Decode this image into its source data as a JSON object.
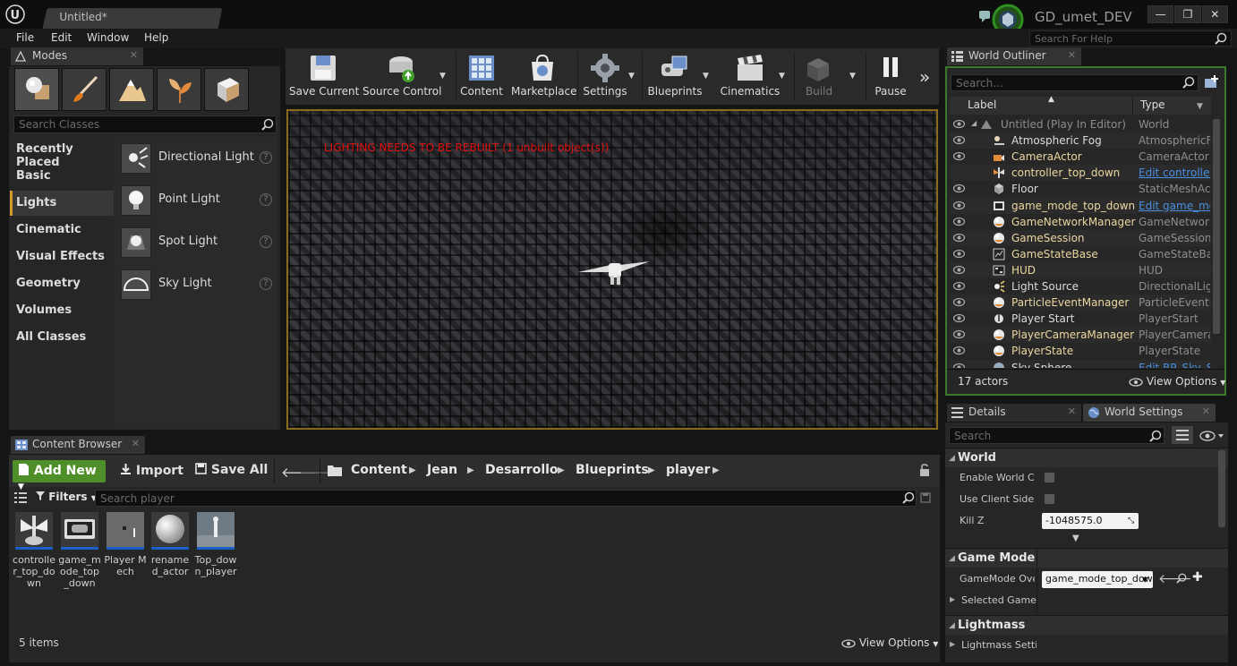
{
  "app": {
    "doc_tab": "Untitled*",
    "project_name": "GD_umet_DEV",
    "window_buttons": [
      "—",
      "❐",
      "✕"
    ]
  },
  "menu": {
    "items": [
      "File",
      "Edit",
      "Window",
      "Help"
    ],
    "search_placeholder": "Search For Help"
  },
  "modes": {
    "tab_label": "Modes",
    "search_placeholder": "Search Classes",
    "categories": [
      "Recently Placed",
      "Basic",
      "Lights",
      "Cinematic",
      "Visual Effects",
      "Geometry",
      "Volumes",
      "All Classes"
    ],
    "active_category": "Lights",
    "lights": [
      "Directional Light",
      "Point Light",
      "Spot Light",
      "Sky Light"
    ],
    "help_glyph": "?"
  },
  "toolbar": {
    "buttons": [
      "Save Current",
      "Source Control",
      "Content",
      "Marketplace",
      "Settings",
      "Blueprints",
      "Cinematics",
      "Build",
      "Pause"
    ],
    "more_glyph": "»"
  },
  "viewport": {
    "warning": "LIGHTING NEEDS TO BE REBUILT (1 unbuilt object(s))",
    "warning_color": "#e01010",
    "border_color": "#8a6b1c"
  },
  "outliner": {
    "tab_label": "World Outliner",
    "search_placeholder": "Search...",
    "col_label": "Label",
    "col_type": "Type",
    "rows": [
      {
        "label": "Untitled (Play In Editor)",
        "type": "World",
        "style": "dim",
        "type_style": "",
        "icon": "world-icon"
      },
      {
        "label": "Atmospheric Fog",
        "type": "AtmosphericFog",
        "style": "",
        "type_style": "",
        "icon": "fog-icon"
      },
      {
        "label": "CameraActor",
        "type": "CameraActor",
        "style": "bp",
        "type_style": "",
        "icon": "camera-icon"
      },
      {
        "label": "controller_top_down",
        "type": "Edit controller_top_down",
        "style": "bp",
        "type_style": "link",
        "icon": "controller-icon"
      },
      {
        "label": "Floor",
        "type": "StaticMeshActor",
        "style": "",
        "type_style": "",
        "icon": "mesh-icon"
      },
      {
        "label": "game_mode_top_down",
        "type": "Edit game_mode_top_down",
        "style": "bp",
        "type_style": "link",
        "icon": "gamemode-icon"
      },
      {
        "label": "GameNetworkManager",
        "type": "GameNetworkManager",
        "style": "bp",
        "type_style": "",
        "icon": "sphere-icon"
      },
      {
        "label": "GameSession",
        "type": "GameSession",
        "style": "bp",
        "type_style": "",
        "icon": "sphere-icon"
      },
      {
        "label": "GameStateBase",
        "type": "GameStateBase",
        "style": "bp",
        "type_style": "",
        "icon": "state-icon"
      },
      {
        "label": "HUD",
        "type": "HUD",
        "style": "bp",
        "type_style": "",
        "icon": "hud-icon"
      },
      {
        "label": "Light Source",
        "type": "DirectionalLight",
        "style": "",
        "type_style": "",
        "icon": "light-icon"
      },
      {
        "label": "ParticleEventManager",
        "type": "ParticleEventManager",
        "style": "bp",
        "type_style": "",
        "icon": "sphere-icon"
      },
      {
        "label": "Player Start",
        "type": "PlayerStart",
        "style": "",
        "type_style": "",
        "icon": "playerstart-icon"
      },
      {
        "label": "PlayerCameraManager",
        "type": "PlayerCameraManager",
        "style": "bp",
        "type_style": "",
        "icon": "sphere-icon"
      },
      {
        "label": "PlayerState",
        "type": "PlayerState",
        "style": "bp",
        "type_style": "",
        "icon": "sphere-icon"
      },
      {
        "label": "Sky Sphere",
        "type": "Edit BP_Sky_Sphere",
        "style": "",
        "type_style": "link",
        "icon": "sky-icon"
      }
    ],
    "actor_count": "17 actors",
    "view_options": "View Options"
  },
  "details": {
    "tab_details": "Details",
    "tab_world_settings": "World Settings",
    "search_placeholder": "Search",
    "sections": {
      "world": "World",
      "game_mode": "Game Mode",
      "lightmass": "Lightmass"
    },
    "props": {
      "enable_world_comp": "Enable World Composition",
      "use_client_side": "Use Client Side Level Streaming Volumes",
      "kill_z": "Kill Z",
      "kill_z_value": "-1048575.0",
      "gamemode_override": "GameMode Override",
      "gamemode_value": "game_mode_top_down",
      "selected_gamemode": "Selected GameMode",
      "lightmass_settings": "Lightmass Settings"
    }
  },
  "content_browser": {
    "tab_label": "Content Browser",
    "add_new": "Add New",
    "import": "Import",
    "save_all": "Save All",
    "breadcrumb": [
      "Content",
      "Jean",
      "Desarrollo",
      "Blueprints",
      "player"
    ],
    "filters": "Filters",
    "search_placeholder": "Search player",
    "assets": [
      "controller_top_down",
      "game_mode_top_down",
      "Player Mech",
      "renamed_actor",
      "Top_down_player"
    ],
    "items_count": "5 items",
    "view_options": "View Options"
  }
}
